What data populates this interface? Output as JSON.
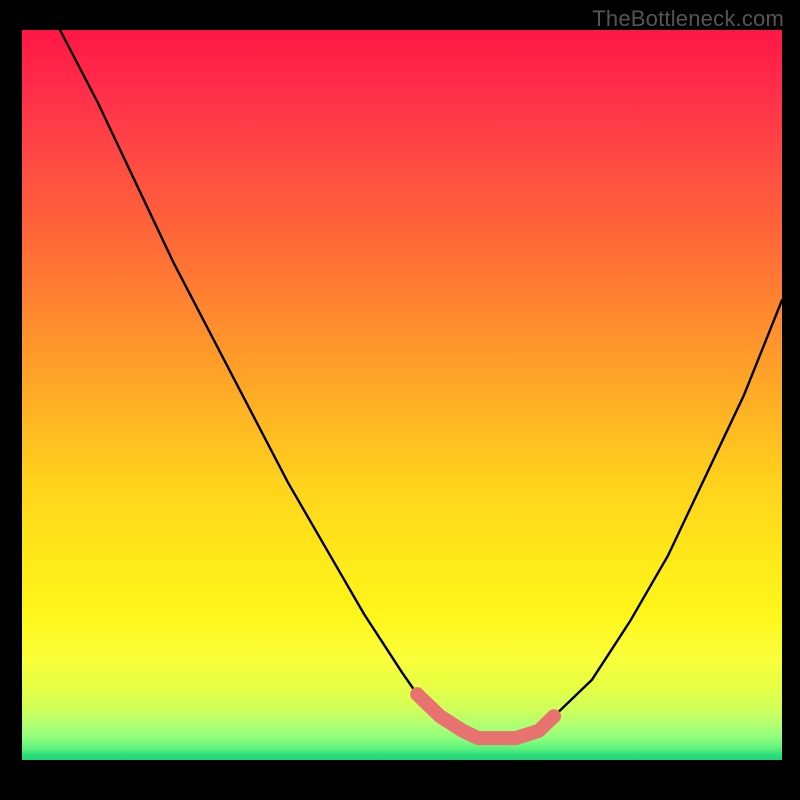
{
  "watermark": "TheBottleneck.com",
  "chart_data": {
    "type": "line",
    "title": "",
    "xlabel": "",
    "ylabel": "",
    "xlim": [
      0,
      100
    ],
    "ylim": [
      0,
      100
    ],
    "grid": false,
    "legend": false,
    "series": [
      {
        "name": "bottleneck-curve",
        "x": [
          0,
          5,
          10,
          15,
          20,
          25,
          30,
          35,
          40,
          45,
          50,
          52,
          55,
          58,
          60,
          63,
          65,
          68,
          70,
          75,
          80,
          85,
          90,
          95,
          100
        ],
        "values": [
          107,
          100,
          90,
          79,
          68,
          58,
          48,
          38,
          29,
          20,
          12,
          9,
          6,
          4,
          3,
          3,
          3,
          4,
          6,
          11,
          19,
          28,
          39,
          50,
          63
        ],
        "stroke": "#000000",
        "stroke_width": 2
      },
      {
        "name": "optimal-band",
        "x": [
          52,
          55,
          58,
          60,
          63,
          65,
          68,
          70
        ],
        "values": [
          9,
          6,
          4,
          3,
          3,
          3,
          4,
          6
        ],
        "stroke": "#e8726f",
        "stroke_width": 12,
        "marker": "circle"
      }
    ],
    "background_gradient": {
      "direction": "vertical",
      "stops": [
        {
          "pos": 0.0,
          "color": "#ff1744"
        },
        {
          "pos": 0.4,
          "color": "#ff8c2e"
        },
        {
          "pos": 0.72,
          "color": "#ffe81a"
        },
        {
          "pos": 0.93,
          "color": "#d0ff5a"
        },
        {
          "pos": 1.0,
          "color": "#1fd678"
        }
      ]
    }
  }
}
